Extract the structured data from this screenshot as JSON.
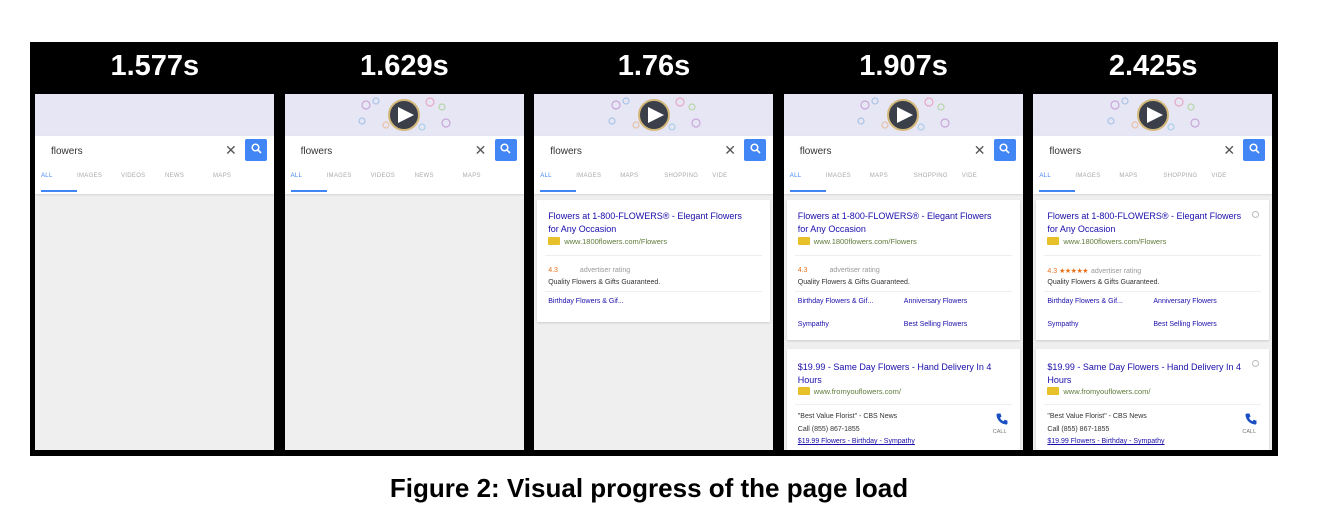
{
  "caption": "Figure 2: Visual progress of the page load",
  "colors": {
    "strip": "#000000",
    "accent": "#4285f4",
    "link": "#1a0dab",
    "rating": "#e7711b"
  },
  "icons": {
    "search": "magnifier-icon",
    "clear": "close-icon",
    "call": "phone-icon",
    "doodle": "play-icon"
  },
  "frames": [
    {
      "time": "1.577s",
      "query": "flowers",
      "clear": "✕",
      "tabs": [
        "ALL",
        "IMAGES",
        "VIDEOS",
        "NEWS",
        "MAPS"
      ]
    },
    {
      "time": "1.629s",
      "query": "flowers",
      "clear": "✕",
      "tabs": [
        "ALL",
        "IMAGES",
        "VIDEOS",
        "NEWS",
        "MAPS"
      ]
    },
    {
      "time": "1.76s",
      "query": "flowers",
      "clear": "✕",
      "tabs": [
        "ALL",
        "IMAGES",
        "MAPS",
        "SHOPPING",
        "VIDE"
      ]
    },
    {
      "time": "1.907s",
      "query": "flowers",
      "clear": "✕",
      "tabs": [
        "ALL",
        "IMAGES",
        "MAPS",
        "SHOPPING",
        "VIDE"
      ]
    },
    {
      "time": "2.425s",
      "query": "flowers",
      "clear": "✕",
      "tabs": [
        "ALL",
        "IMAGES",
        "MAPS",
        "SHOPPING",
        "VIDE"
      ]
    }
  ],
  "ad1": {
    "title": "Flowers at 1-800-FLOWERS® - Elegant Flowers for Any Occasion",
    "url": "www.1800flowers.com/Flowers",
    "rating": "4.3",
    "stars": "★★★★★",
    "rating_label": "advertiser rating",
    "description": "Quality Flowers & Gifts Guaranteed.",
    "sitelink_1": "Birthday Flowers & Gif...",
    "sitelink_2": "Anniversary Flowers",
    "sitelink_3": "Sympathy",
    "sitelink_4": "Best Selling Flowers"
  },
  "ad2": {
    "title": "$19.99 - Same Day Flowers - Hand Delivery In 4 Hours",
    "url": "www.fromyouflowers.com/",
    "review": "\"Best Value Florist\" - CBS News",
    "phone": "Call (855) 867-1855",
    "links": "$19.99 Flowers - Birthday - Sympathy",
    "call_label": "CALL"
  }
}
